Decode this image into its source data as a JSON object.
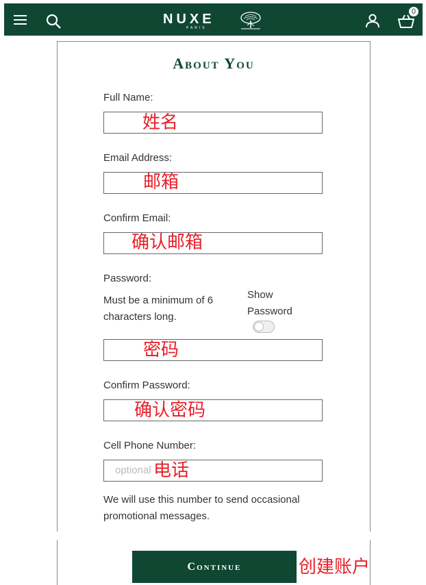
{
  "header": {
    "brand": "NUXE",
    "brand_sub": "PARIS",
    "basket_count": "0"
  },
  "form": {
    "title": "About You",
    "full_name": {
      "label": "Full Name:",
      "annotation": "姓名"
    },
    "email": {
      "label": "Email Address:",
      "annotation": "邮箱"
    },
    "confirm_email": {
      "label": "Confirm Email:",
      "annotation": "确认邮箱"
    },
    "password": {
      "label": "Password:",
      "hint": "Must be a minimum of 6 characters long.",
      "show_label": "Show Password",
      "show_toggle_on": false,
      "annotation": "密码"
    },
    "confirm_password": {
      "label": "Confirm Password:",
      "annotation": "确认密码"
    },
    "phone": {
      "label": "Cell Phone Number:",
      "placeholder": "optional",
      "annotation": "电话",
      "note": "We will use this number to send occasional promotional messages."
    },
    "continue_label": "Continue",
    "continue_annotation": "创建账户"
  },
  "colors": {
    "brand_green": "#0f4733",
    "annotation_red": "#e8202a"
  },
  "icons": [
    "menu-icon",
    "search-icon",
    "nuxe-tree-logo",
    "account-icon",
    "basket-icon"
  ]
}
